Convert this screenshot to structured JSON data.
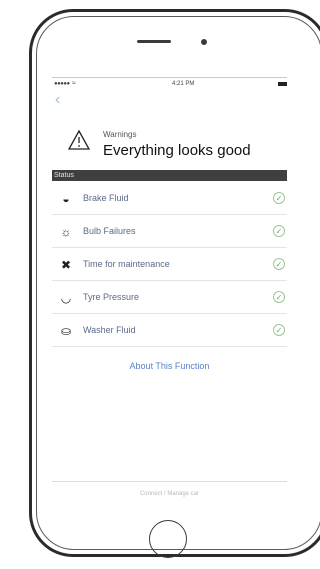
{
  "status_bar": {
    "signal": "●●●●● ",
    "wifi": "≈",
    "time": "4:21 PM"
  },
  "nav": {
    "back_glyph": "‹"
  },
  "header": {
    "subtitle": "Warnings",
    "title": "Everything looks good",
    "icon": "warning-triangle-icon"
  },
  "section_label": "Status",
  "items": [
    {
      "label": "Brake Fluid",
      "icon": "brake-fluid-icon",
      "glyph": "◒"
    },
    {
      "label": "Bulb Failures",
      "icon": "bulb-icon",
      "glyph": "☼"
    },
    {
      "label": "Time for maintenance",
      "icon": "wrench-icon",
      "glyph": "✖"
    },
    {
      "label": "Tyre Pressure",
      "icon": "tyre-icon",
      "glyph": "◡"
    },
    {
      "label": "Washer Fluid",
      "icon": "washer-icon",
      "glyph": "⛀"
    }
  ],
  "check_glyph": "✓",
  "about_link": "About This Function",
  "footer": "Connect / Manage car",
  "colors": {
    "accent": "#5b80c8",
    "section_bar": "#3f3f3f",
    "ok": "#6aa86a"
  }
}
